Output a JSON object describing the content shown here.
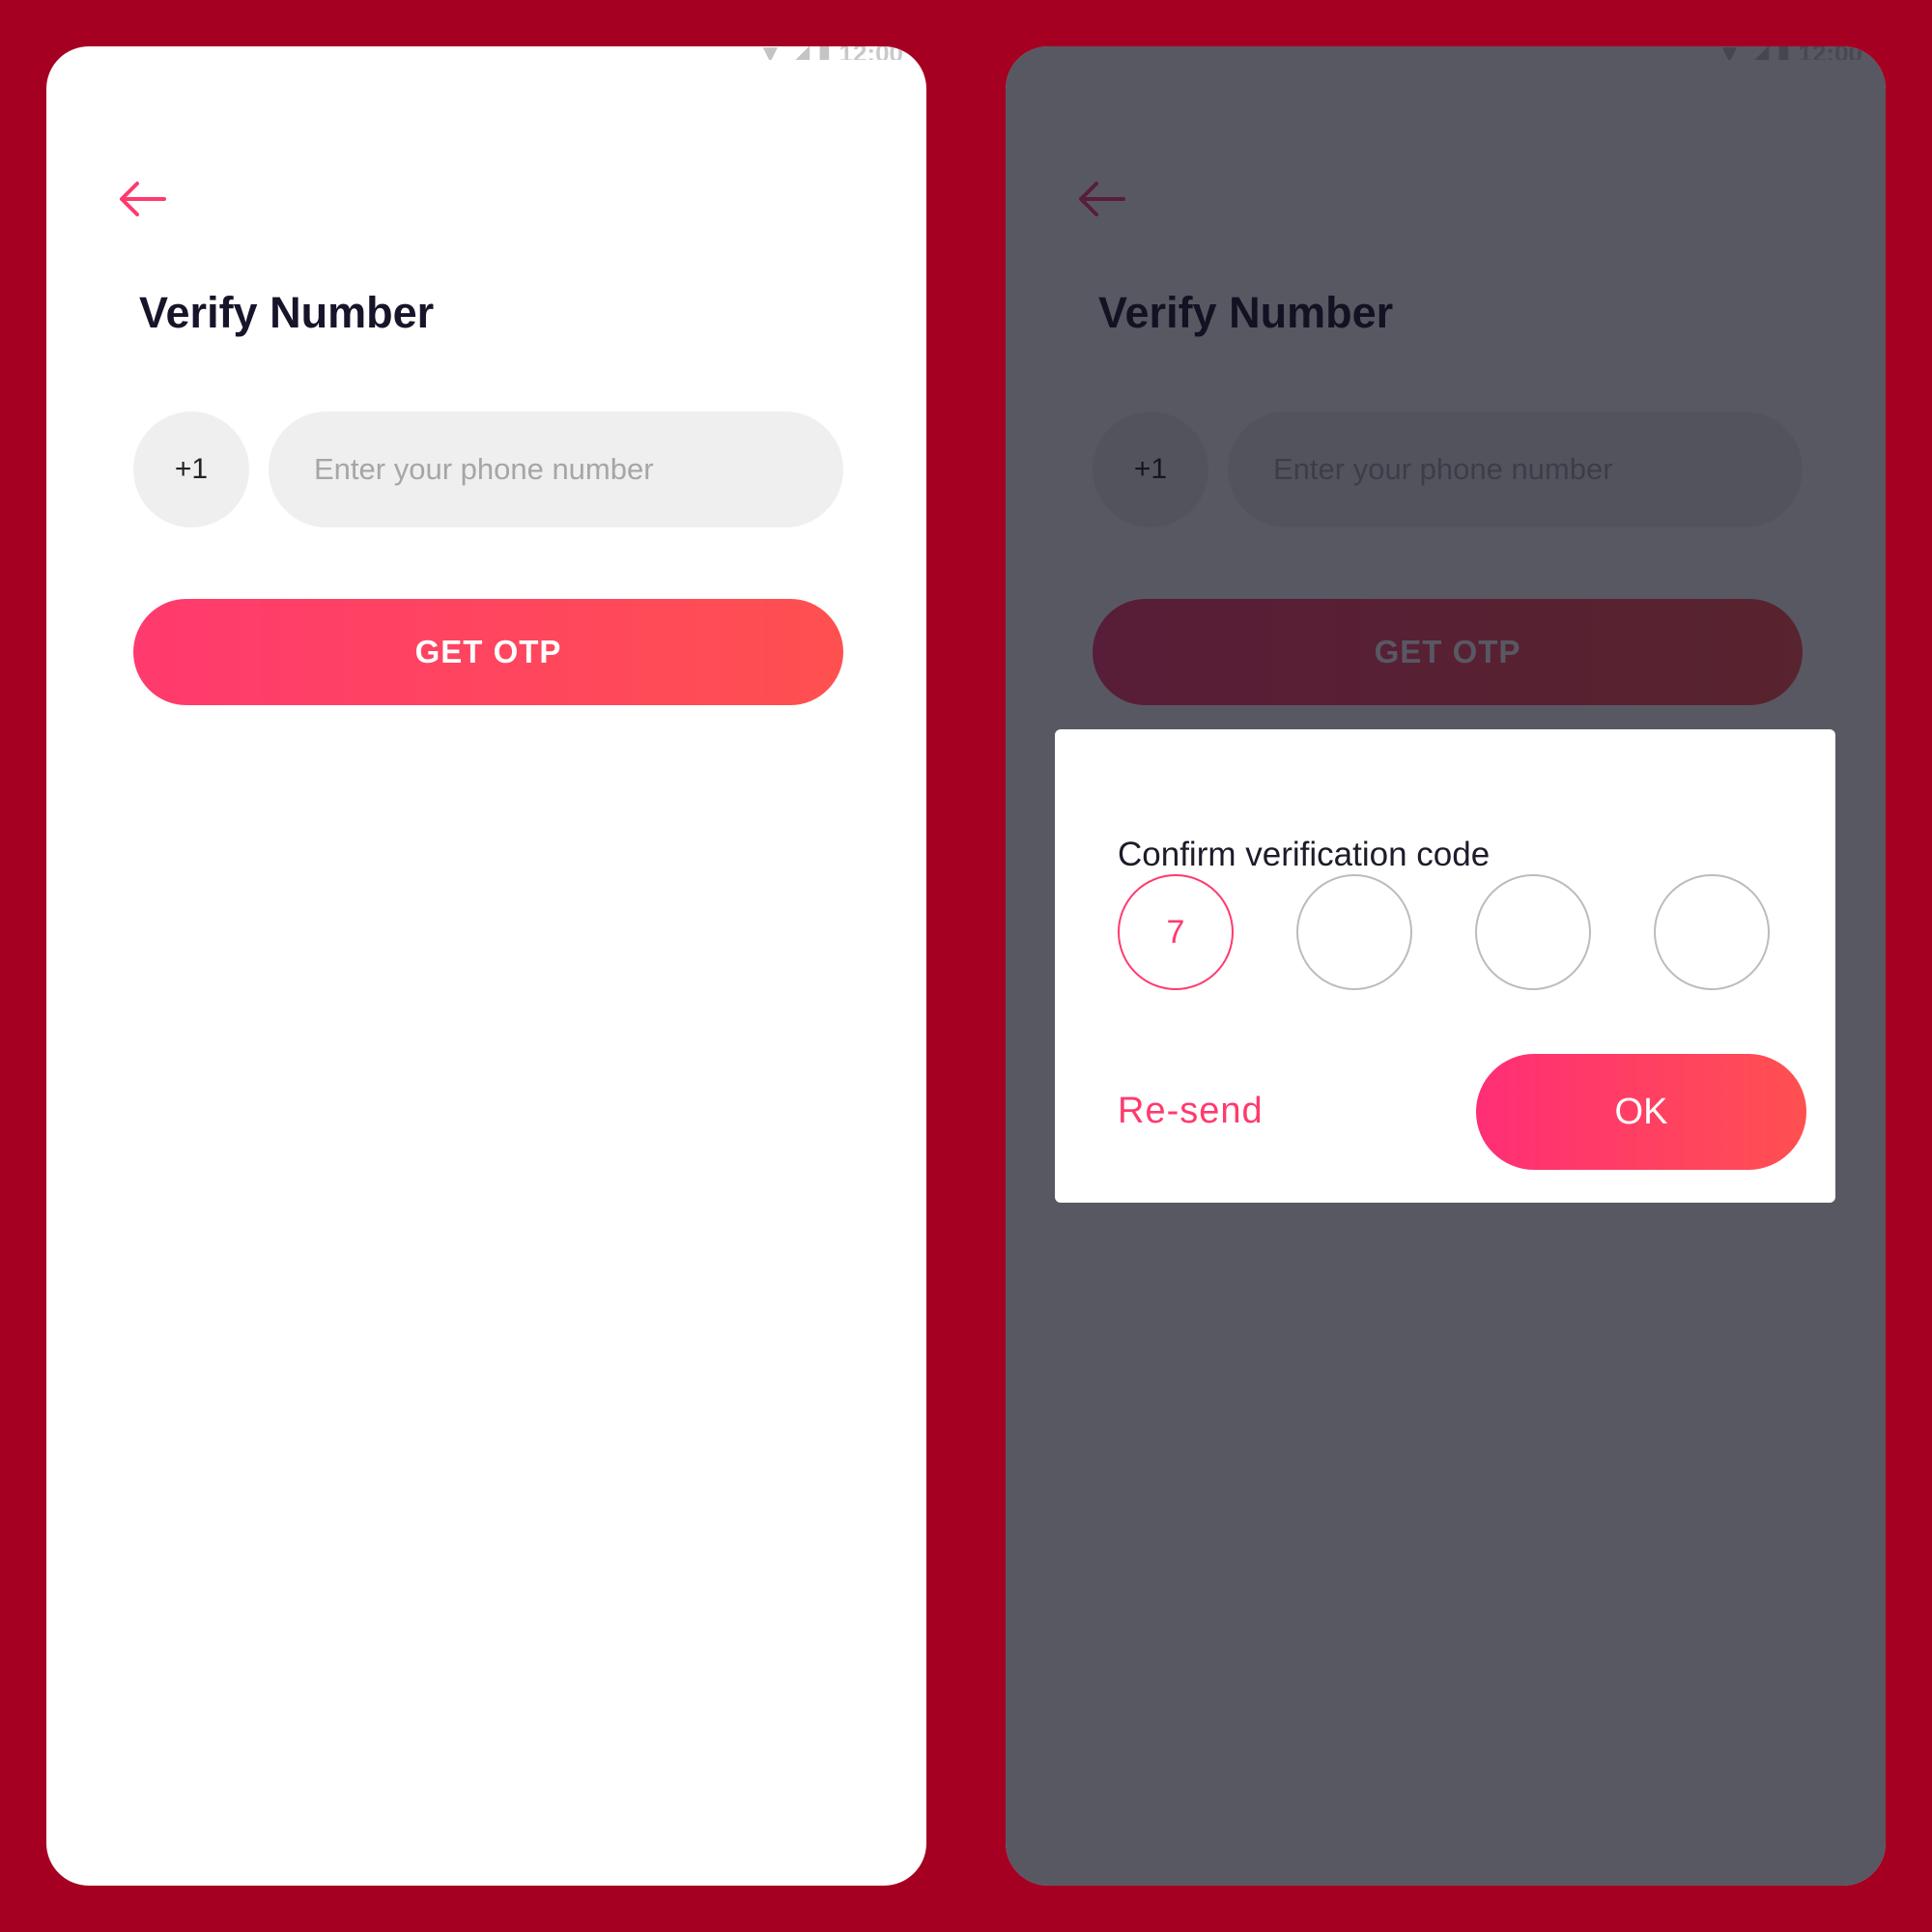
{
  "theme": {
    "background": "#a50021",
    "accent": "#ff3a6e",
    "accent_end": "#ff5050",
    "input_bg": "#efefef",
    "overlay": "rgba(17,17,33,0.7)"
  },
  "status_bar": {
    "time": "12:00",
    "icons": [
      "wifi-icon",
      "signal-icon",
      "battery-icon"
    ]
  },
  "screen": {
    "back_icon": "arrow-left-icon",
    "title": "Verify Number",
    "country_code": "+1",
    "phone_placeholder": "Enter your phone number",
    "get_otp_label": "GET OTP"
  },
  "dialog": {
    "title": "Confirm verification code",
    "code_digits": [
      "7",
      "",
      "",
      ""
    ],
    "resend_label": "Re-send",
    "ok_label": "OK"
  }
}
